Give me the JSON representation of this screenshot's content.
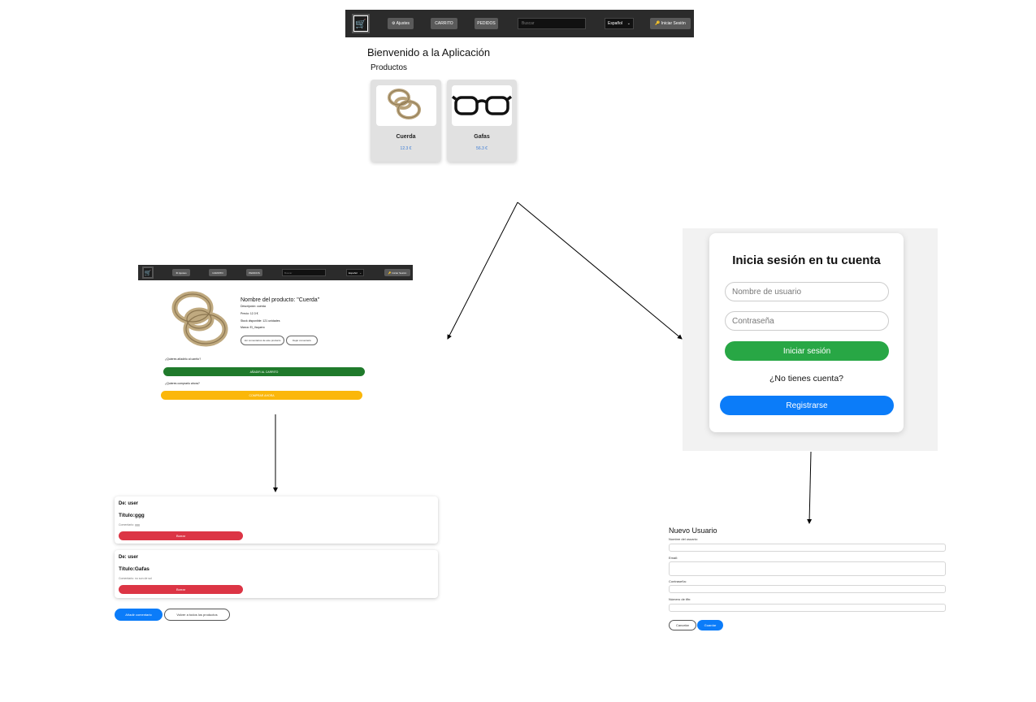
{
  "navbar": {
    "ajustes_label": "⚙ Ajustes",
    "carrito_label": "CARRITO",
    "pedidos_label": "PEDIDOS",
    "search_placeholder": "Buscar",
    "language_label": "Español",
    "login_label": "🔑 Iniciar Sesión"
  },
  "home": {
    "welcome_title": "Bienvenido a la Aplicación",
    "products_heading": "Productos",
    "products": [
      {
        "name": "Cuerda",
        "price": "12.3 €"
      },
      {
        "name": "Gafas",
        "price": "56.3 €"
      }
    ]
  },
  "product_detail": {
    "title": "Nombre del producto: \"Cuerda\"",
    "description": "Descripción: cuerda",
    "price": "Precio: 12.3 €",
    "stock": "Stock disponible: 121 unidades",
    "brand": "Marca: El_Vaquero",
    "btn_view_comments": "Ver comentarios de este producto",
    "btn_comment": "Dejar comentario",
    "question_cart": "¿Quieres añadirlo al carrito?",
    "btn_add_cart": "AÑADIR AL CARRITO",
    "question_buy": "¿Quieres comprarlo ahora?",
    "btn_buy": "COMPRAR AHORA"
  },
  "comments": {
    "items": [
      {
        "author": "De: user",
        "title": "Título:ggg",
        "comment": "Comentario: ggg",
        "delete_label": "Borrar"
      },
      {
        "author": "De: user",
        "title": "Título:Gafas",
        "comment": "Comentario: no son de sol",
        "delete_label": "Borrar"
      }
    ],
    "btn_add_comment": "Añadir comentario",
    "btn_back_products": "Volver a todos los productos"
  },
  "login": {
    "title": "Inicia sesión en tu cuenta",
    "username_placeholder": "Nombre de usuario",
    "password_placeholder": "Contraseña",
    "login_button": "Iniciar sesión",
    "no_account_text": "¿No tienes cuenta?",
    "register_button": "Registrarse"
  },
  "new_user": {
    "title": "Nuevo Usuario",
    "label_username": "Nombre del usuario:",
    "label_email": "Email:",
    "label_password": "Contraseña:",
    "label_phone": "Número de tlfn:",
    "btn_cancel": "Cancelar",
    "btn_save": "Guardar"
  },
  "colors": {
    "navbar_bg": "#2b2b2b",
    "primary_blue": "#0b7cf9",
    "success_green": "#28a745",
    "dark_green": "#1f7a2b",
    "danger_red": "#dc3545",
    "warning_yellow": "#fbb70b",
    "price_blue": "#3a7bd5"
  }
}
